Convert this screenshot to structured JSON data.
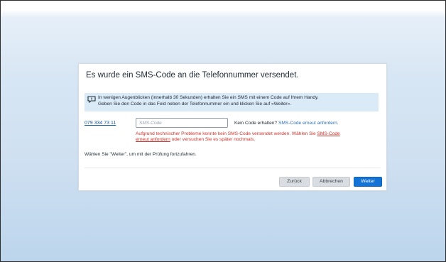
{
  "dialog": {
    "title": "Es wurde ein SMS-Code an die Telefonnummer versendet.",
    "info": {
      "icon": "message-icon",
      "line1": "In wenigen Augenblicken (innerhalb 30 Sekunden) erhalten Sie ein SMS mit einem Code auf Ihrem Handy.",
      "line2": "Geben Sie den Code in das Feld neben der Telefonnummer ein und klicken Sie auf «Weiter»."
    },
    "phone_number": "079 334 73 11",
    "sms_input": {
      "placeholder": "SMS-Code",
      "value": ""
    },
    "no_code_text": "Kein Code erhalten?",
    "resend_link": "SMS-Code erneut anfordern.",
    "error": {
      "line1_pre": "Aufgrund technischer Probleme konnte kein SMS-Code versendet werden. Wählen Sie ",
      "link_part1": "SMS-Code",
      "link_part2": "erneut anfordern",
      "line2_post": " oder versuchen Sie es später nochmals."
    },
    "note": "Wählen Sie \"Weiter\", um mit der Prüfung fortzufahren.",
    "buttons": {
      "back": "Zurück",
      "cancel": "Abbrechen",
      "next": "Weiter"
    }
  },
  "colors": {
    "primary_button": "#1473d6",
    "error": "#d0322a",
    "link": "#2a6fb8",
    "info_bg": "#dbeaf7"
  }
}
